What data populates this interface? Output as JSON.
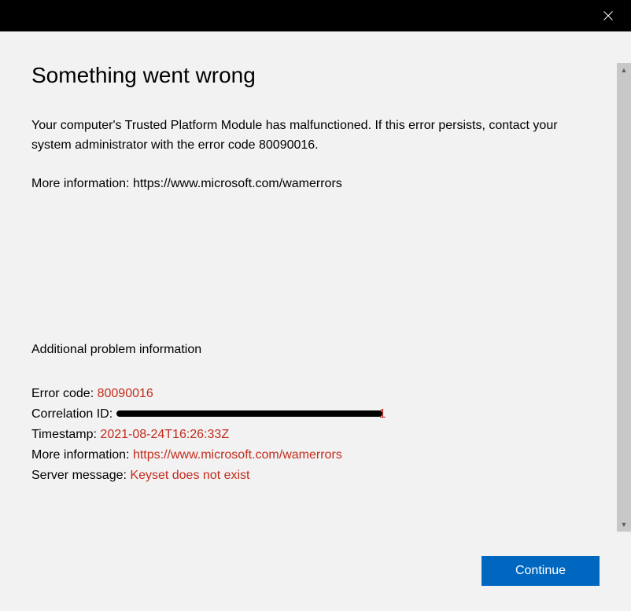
{
  "header": {
    "title": "Something went wrong"
  },
  "body": {
    "main_message": "Your computer's Trusted Platform Module has malfunctioned. If this error persists, contact your system administrator with the error code 80090016.",
    "more_info_label": "More information: ",
    "more_info_url": "https://www.microsoft.com/wamerrors"
  },
  "details": {
    "section_title": "Additional problem information",
    "error_code_label": "Error code: ",
    "error_code_value": "80090016",
    "correlation_label": "Correlation ID: ",
    "correlation_value_redacted": true,
    "timestamp_label": "Timestamp: ",
    "timestamp_value": "2021-08-24T16:26:33Z",
    "more_info_label": "More information: ",
    "more_info_value": "https://www.microsoft.com/wamerrors",
    "server_message_label": "Server message: ",
    "server_message_value": "Keyset does not exist"
  },
  "buttons": {
    "continue_label": "Continue"
  }
}
